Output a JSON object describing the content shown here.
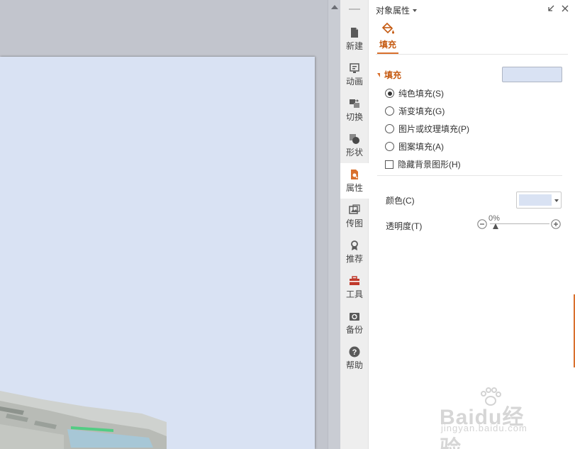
{
  "panel": {
    "title": "对象属性",
    "fill_tab_label": "填充"
  },
  "tabs": [
    {
      "label": "新建",
      "icon": "new-doc-icon"
    },
    {
      "label": "动画",
      "icon": "animation-icon"
    },
    {
      "label": "切换",
      "icon": "transition-icon"
    },
    {
      "label": "形状",
      "icon": "shapes-icon"
    },
    {
      "label": "属性",
      "icon": "properties-icon",
      "active": true
    },
    {
      "label": "传图",
      "icon": "upload-image-icon"
    },
    {
      "label": "推荐",
      "icon": "recommend-icon"
    },
    {
      "label": "工具",
      "icon": "toolbox-icon"
    },
    {
      "label": "备份",
      "icon": "backup-icon"
    },
    {
      "label": "帮助",
      "icon": "help-icon"
    }
  ],
  "fill": {
    "section_label": "填充",
    "preview_color": "#d9e2f3",
    "options": [
      {
        "label": "纯色填充(S)",
        "selected": true
      },
      {
        "label": "渐变填充(G)",
        "selected": false
      },
      {
        "label": "图片或纹理填充(P)",
        "selected": false
      },
      {
        "label": "图案填充(A)",
        "selected": false
      }
    ],
    "hide_background_label": "隐藏背景图形(H)",
    "hide_background_checked": false,
    "color_label": "颜色(C)",
    "color_value": "#d9e2f3",
    "transparency_label": "透明度(T)",
    "transparency_value": "0%",
    "transparency_level": 0
  },
  "watermark": {
    "brand": "Baidu经验",
    "url": "jingyan.baidu.com"
  },
  "colors": {
    "accent": "#d9702d",
    "slide_background": "#d9e2f3",
    "workspace": "#c2c5cd"
  }
}
